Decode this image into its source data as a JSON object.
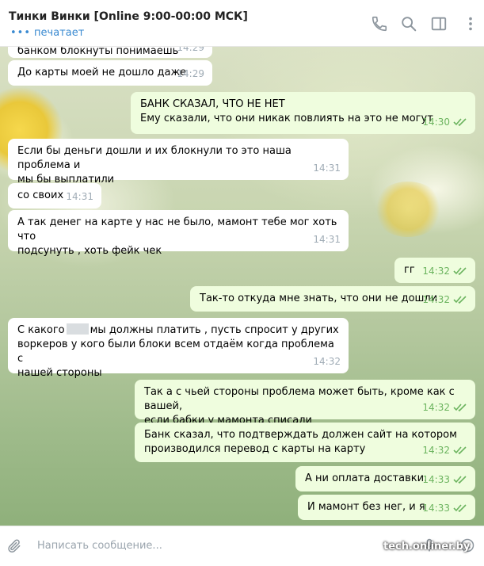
{
  "header": {
    "title": "Тинки Винки [Online 9:00-00:00 МСК]",
    "status_dots": "•••",
    "status": "печатает"
  },
  "icons": {
    "call": "phone-icon",
    "search": "search-icon",
    "sidebar": "sidebar-icon",
    "menu": "more-vertical-icon",
    "attach": "paperclip-icon",
    "mic": "microphone-icon",
    "emoji": "emoji-icon"
  },
  "messages": [
    {
      "dir": "in",
      "text": "банком блокнуты понимаешь",
      "time": "14:29"
    },
    {
      "dir": "in",
      "text": "До карты моей не дошло даже",
      "time": "14:29"
    },
    {
      "dir": "out",
      "lines": [
        "БАНК СКАЗАЛ, ЧТО НЕ НЕТ",
        "Ему сказали, что они никак повлиять на это не могут"
      ],
      "time": "14:30"
    },
    {
      "dir": "in",
      "lines": [
        "Если бы деньги дошли и их блокнули то это наша проблема и",
        "мы бы выплатили"
      ],
      "time": "14:31"
    },
    {
      "dir": "in",
      "text": "со своих",
      "time": "14:31"
    },
    {
      "dir": "in",
      "lines": [
        "А так денег на карте у нас не было, мамонт тебе мог хоть что",
        "подсунуть , хоть фейк чек"
      ],
      "time": "14:31"
    },
    {
      "dir": "out",
      "text": "гг",
      "time": "14:32"
    },
    {
      "dir": "out",
      "text": "Так-то откуда мне знать, что они не дошли",
      "time": "14:32"
    },
    {
      "dir": "in",
      "line1a": "С какого",
      "line1b": "мы должны платить , пусть спросит у других",
      "lines": [
        "воркеров у кого были блоки всем отдаём когда проблема с",
        "нашей стороны"
      ],
      "time": "14:32"
    },
    {
      "dir": "out",
      "lines": [
        "Так а с чьей стороны проблема может быть, кроме как с вашей,",
        "если бабки у мамонта списали"
      ],
      "time": "14:32"
    },
    {
      "dir": "out",
      "lines": [
        "Банк сказал, что подтверждать должен сайт на котором",
        "производился перевод с карты на карту"
      ],
      "time": "14:32"
    },
    {
      "dir": "out",
      "text": "А ни оплата доставки.",
      "time": "14:33"
    },
    {
      "dir": "out",
      "text": "И мамонт без нег, и я",
      "time": "14:33"
    }
  ],
  "composer": {
    "placeholder": "Написать сообщение..."
  },
  "watermark": "tech.onliner.by",
  "colors": {
    "incoming_bubble": "#ffffff",
    "outgoing_bubble": "#effdde",
    "accent": "#3a8ad1",
    "read_ticks": "#6cb45f"
  }
}
